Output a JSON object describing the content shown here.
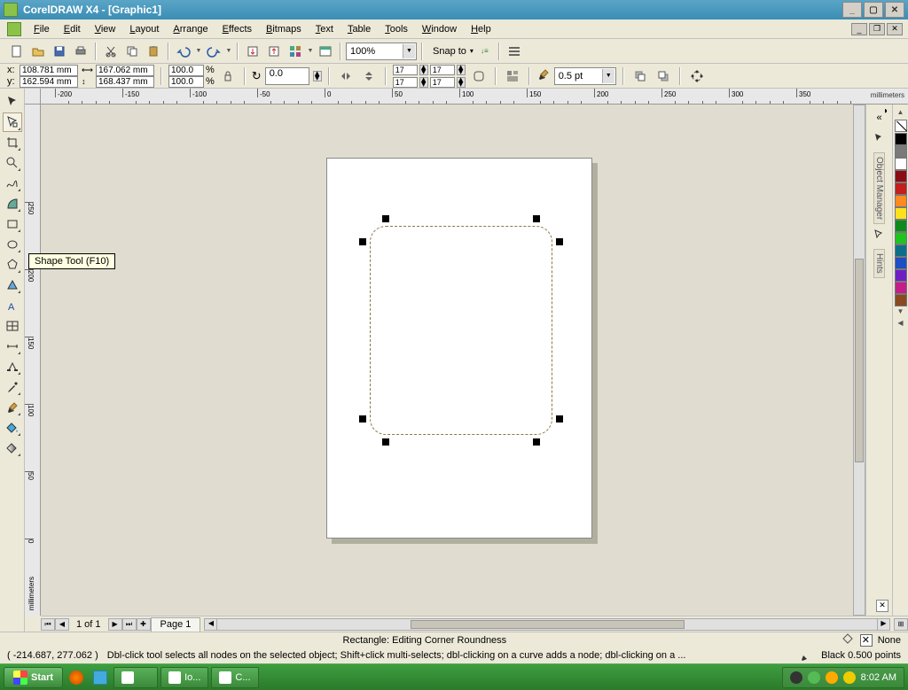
{
  "title": "CorelDRAW X4 - [Graphic1]",
  "menus": [
    "File",
    "Edit",
    "View",
    "Layout",
    "Arrange",
    "Effects",
    "Bitmaps",
    "Text",
    "Table",
    "Tools",
    "Window",
    "Help"
  ],
  "toolbar": {
    "zoom": "100%",
    "snap_label": "Snap to"
  },
  "propbar": {
    "x": "108.781 mm",
    "y": "162.594 mm",
    "w": "167.062 mm",
    "h": "168.437 mm",
    "sx": "100.0",
    "sy": "100.0",
    "rot": "0.0",
    "corner": "17",
    "outline_width": "0.5 pt"
  },
  "tooltip": "Shape Tool (F10)",
  "ruler_units": "millimeters",
  "dockers": {
    "label1": "Object Manager",
    "label2": "Hints"
  },
  "palette": [
    "#000000",
    "#7a7a7a",
    "#ffffff",
    "#8a0d15",
    "#c41e1e",
    "#ff8a1f",
    "#ffe01f",
    "#0d8a1f",
    "#1fc41f",
    "#0d6e8a",
    "#1e4ec4",
    "#6e1fc4",
    "#c41e8a",
    "#8a4a1f"
  ],
  "tabs": {
    "page_info": "1 of 1",
    "page_name": "Page 1"
  },
  "status": {
    "mid": "Rectangle: Editing Corner Roundness",
    "fill_label": "None",
    "coords": "( -214.687, 277.062 )",
    "hint": "Dbl-click tool selects all nodes on the selected object; Shift+click multi-selects; dbl-clicking on a curve adds a node; dbl-clicking on a ...",
    "outline_label": "Black  0.500 points"
  },
  "taskbar": {
    "start": "Start",
    "tasks": [
      "",
      "Io...",
      "C..."
    ],
    "clock": "8:02 AM"
  },
  "hruler_ticks": [
    -200,
    -150,
    -100,
    -50,
    0,
    50,
    100,
    150,
    200,
    250,
    300,
    350
  ],
  "vruler_ticks": [
    250,
    200,
    150,
    100,
    50,
    0
  ]
}
